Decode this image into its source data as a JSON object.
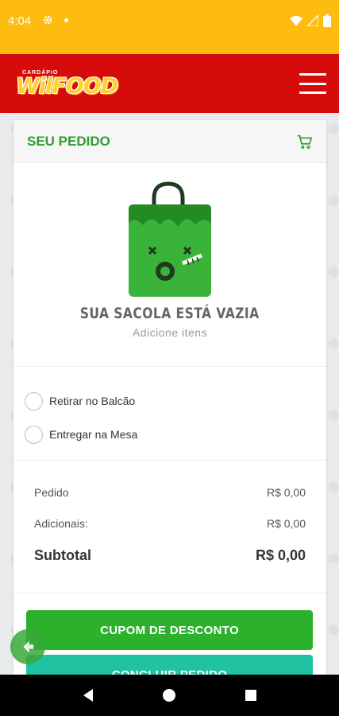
{
  "status_bar": {
    "time": "4:04"
  },
  "header": {
    "logo_small": "CARDÁPIO",
    "logo_main": "WilFOOD"
  },
  "order": {
    "title": "SEU PEDIDO",
    "empty_title": "SUA SACOLA ESTÁ VAZIA",
    "empty_subtitle": "Adicione itens",
    "options": [
      {
        "label": "Retirar no Balcão",
        "selected": false
      },
      {
        "label": "Entregar na Mesa",
        "selected": false
      }
    ],
    "summary": {
      "pedido_label": "Pedido",
      "pedido_value": "R$ 0,00",
      "adicionais_label": "Adicionais:",
      "adicionais_value": "R$ 0,00",
      "subtotal_label": "Subtotal",
      "subtotal_value": "R$ 0,00"
    },
    "coupon_button": "CUPOM DE DESCONTO",
    "finish_button": "CONCLUIR PEDIDO"
  },
  "colors": {
    "status_bar": "#fdbc0e",
    "header": "#d60c0c",
    "accent_green": "#2bb12b",
    "teal": "#21c2a2"
  }
}
